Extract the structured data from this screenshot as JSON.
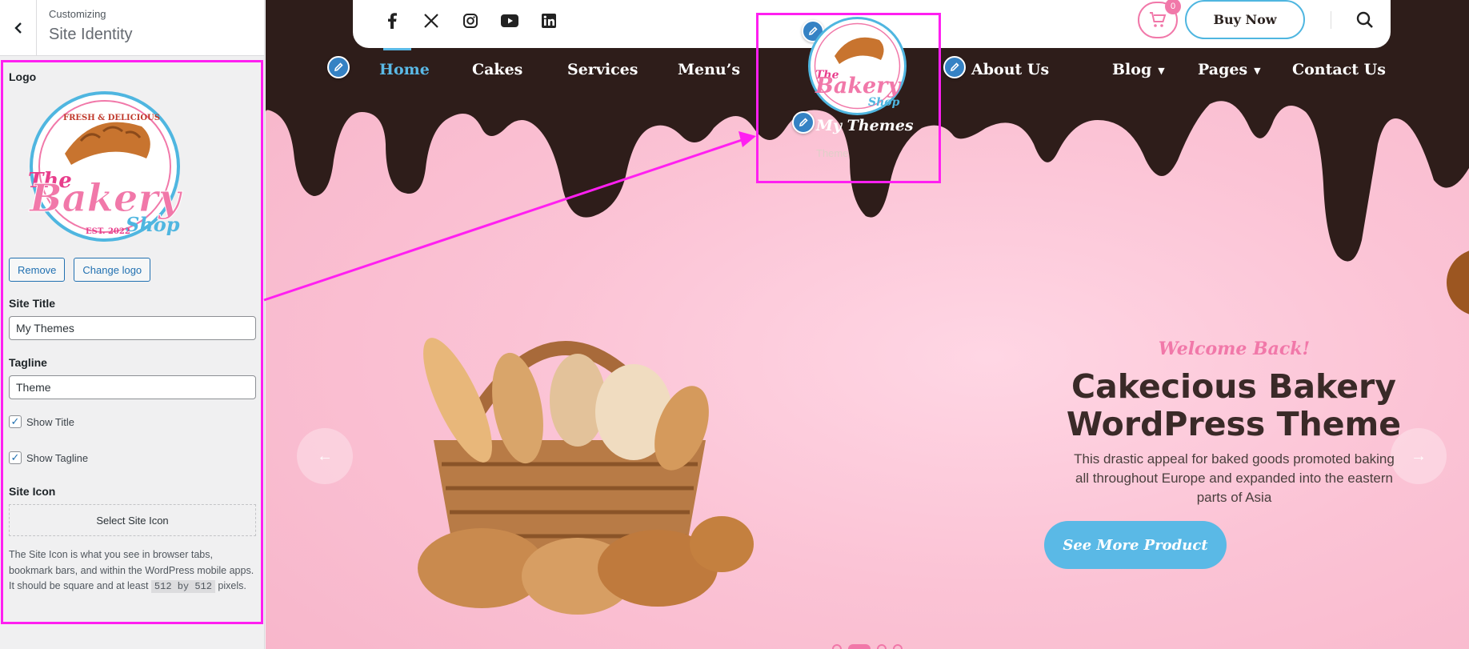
{
  "customizer": {
    "kicker": "Customizing",
    "section_title": "Site Identity",
    "logo_label": "Logo",
    "remove_label": "Remove",
    "change_logo_label": "Change logo",
    "site_title_label": "Site Title",
    "site_title_value": "My Themes",
    "tagline_label": "Tagline",
    "tagline_value": "Theme",
    "show_title_label": "Show Title",
    "show_title_checked": true,
    "show_tagline_label": "Show Tagline",
    "show_tagline_checked": true,
    "site_icon_label": "Site Icon",
    "select_site_icon_label": "Select Site Icon",
    "site_icon_desc_before": "The Site Icon is what you see in browser tabs, bookmark bars, and within the WordPress mobile apps. It should be square and at least",
    "site_icon_code": "512 by 512",
    "site_icon_desc_after": "pixels."
  },
  "logo": {
    "top_text": "FRESH & DELICIOUS",
    "the": "The",
    "bakery": "Bakery",
    "shop": "Shop",
    "est": "EST. 2022"
  },
  "preview": {
    "social_icons": [
      "facebook-icon",
      "x-twitter-icon",
      "instagram-icon",
      "youtube-icon",
      "linkedin-icon"
    ],
    "cart_count": "0",
    "buy_now": "Buy Now",
    "nav": {
      "home": "Home",
      "cakes": "Cakes",
      "services": "Services",
      "menus": "Menu’s",
      "about": "About Us",
      "blog": "Blog",
      "pages": "Pages",
      "contact": "Contact Us"
    },
    "site_title": "My Themes",
    "tagline": "Theme",
    "hero": {
      "welcome": "Welcome Back!",
      "title": "Cakecious Bakery WordPress Theme",
      "description": "This drastic appeal for baked goods promoted baking all throughout Europe and expanded into the eastern parts of Asia",
      "cta": "See More Product"
    }
  },
  "colors": {
    "highlight": "#ff1ff1",
    "chocolate": "#2e1d1a",
    "pink_accent": "#f178a9",
    "blue_accent": "#5ab9e6",
    "wp_blue": "#2271b1"
  }
}
